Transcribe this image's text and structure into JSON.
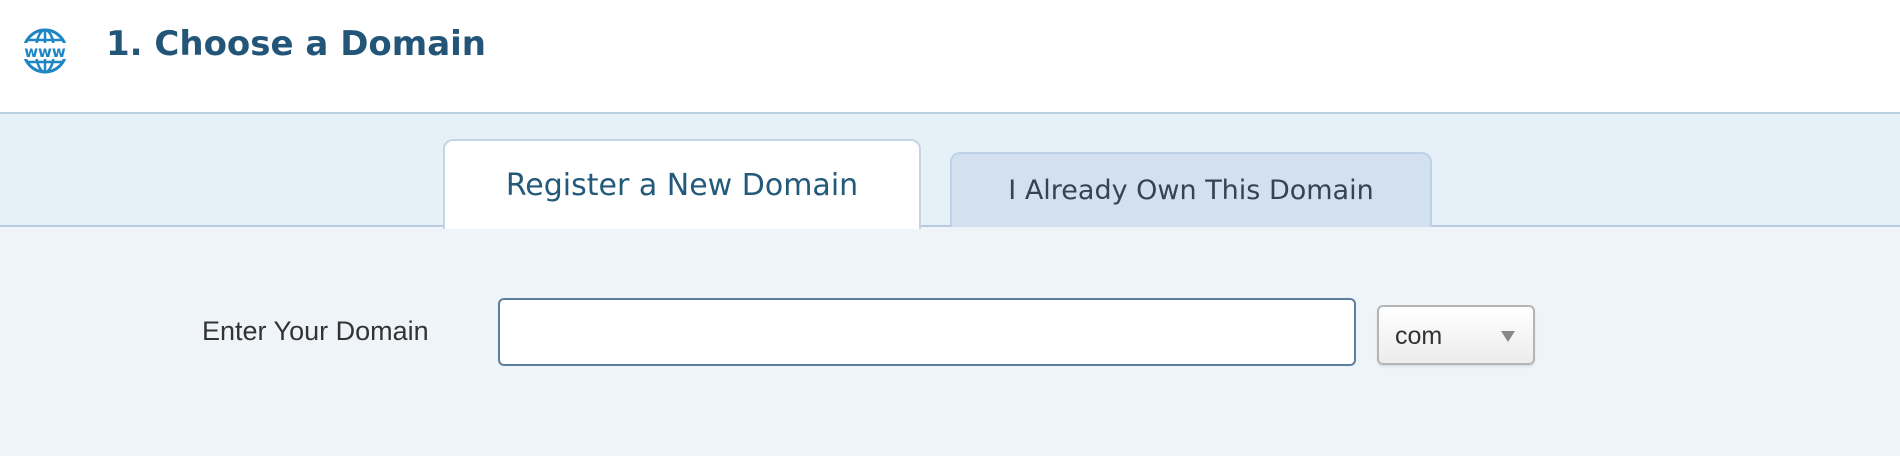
{
  "header": {
    "title": "1. Choose a Domain",
    "icon": "www-globe-icon",
    "icon_text": "www"
  },
  "tabs": [
    {
      "label": "Register a New Domain",
      "active": true
    },
    {
      "label": "I Already Own This Domain",
      "active": false
    }
  ],
  "form": {
    "domain_label": "Enter Your Domain",
    "domain_value": "",
    "domain_placeholder": "",
    "tld_selected": "com"
  },
  "colors": {
    "title": "#225577",
    "globe": "#1f86c4",
    "tab_strip_bg": "#e6f0f7",
    "content_bg": "#eff4f9",
    "inactive_tab_bg": "#d3e0ef"
  }
}
